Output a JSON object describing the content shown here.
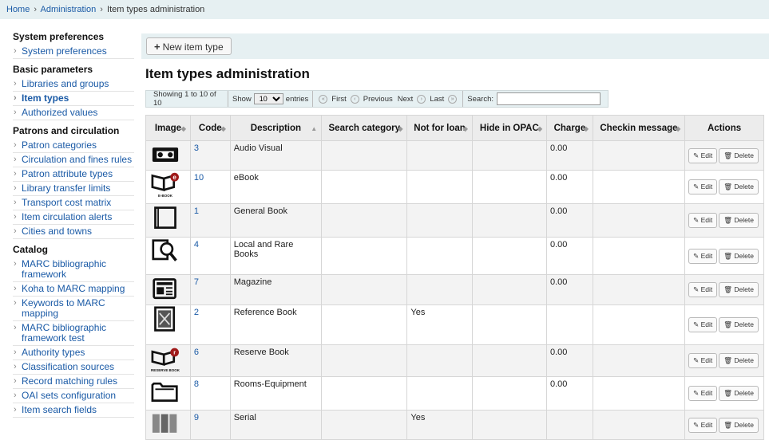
{
  "breadcrumbs": {
    "home": "Home",
    "sep": "›",
    "administration": "Administration",
    "current": "Item types administration"
  },
  "sidebar": {
    "sections": [
      {
        "title": "System preferences",
        "items": [
          {
            "label": "System preferences"
          }
        ]
      },
      {
        "title": "Basic parameters",
        "items": [
          {
            "label": "Libraries and groups"
          },
          {
            "label": "Item types",
            "active": true
          },
          {
            "label": "Authorized values"
          }
        ]
      },
      {
        "title": "Patrons and circulation",
        "items": [
          {
            "label": "Patron categories"
          },
          {
            "label": "Circulation and fines rules"
          },
          {
            "label": "Patron attribute types"
          },
          {
            "label": "Library transfer limits"
          },
          {
            "label": "Transport cost matrix"
          },
          {
            "label": "Item circulation alerts"
          },
          {
            "label": "Cities and towns"
          }
        ]
      },
      {
        "title": "Catalog",
        "items": [
          {
            "label": "MARC bibliographic framework"
          },
          {
            "label": "Koha to MARC mapping"
          },
          {
            "label": "Keywords to MARC mapping"
          },
          {
            "label": "MARC bibliographic framework test"
          },
          {
            "label": "Authority types"
          },
          {
            "label": "Classification sources"
          },
          {
            "label": "Record matching rules"
          },
          {
            "label": "OAI sets configuration"
          },
          {
            "label": "Item search fields"
          }
        ]
      }
    ]
  },
  "toolbar": {
    "new_label": "New item type",
    "plus": "+"
  },
  "page_title": "Item types administration",
  "pager": {
    "showing": "Showing 1 to 10 of 10",
    "show": "Show",
    "length": "10",
    "entries": "entries",
    "first": "First",
    "previous": "Previous",
    "next": "Next",
    "last": "Last",
    "search_label": "Search:",
    "search_value": ""
  },
  "table": {
    "headers": {
      "image": "Image",
      "code": "Code",
      "description": "Description",
      "search_category": "Search category",
      "not_for_loan": "Not for loan",
      "hide_opac": "Hide in OPAC",
      "charge": "Charge",
      "checkin_message": "Checkin message",
      "actions": "Actions"
    },
    "edit_label": "Edit",
    "delete_label": "Delete",
    "rows": [
      {
        "icon": "video-cassette-icon",
        "code": "3",
        "description": "Audio Visual",
        "search_category": "",
        "not_for_loan": "",
        "hide_opac": "",
        "charge": "0.00",
        "checkin_message": ""
      },
      {
        "icon": "ebook-icon",
        "icon_caption": "E-BOOK",
        "code": "10",
        "description": "eBook",
        "search_category": "",
        "not_for_loan": "",
        "hide_opac": "",
        "charge": "0.00",
        "checkin_message": ""
      },
      {
        "icon": "book-icon",
        "code": "1",
        "description": "General Book",
        "search_category": "",
        "not_for_loan": "",
        "hide_opac": "",
        "charge": "0.00",
        "checkin_message": ""
      },
      {
        "icon": "magnifier-book-icon",
        "code": "4",
        "description": "Local and Rare Books",
        "search_category": "",
        "not_for_loan": "",
        "hide_opac": "",
        "charge": "0.00",
        "checkin_message": ""
      },
      {
        "icon": "magazine-icon",
        "code": "7",
        "description": "Magazine",
        "search_category": "",
        "not_for_loan": "",
        "hide_opac": "",
        "charge": "0.00",
        "checkin_message": ""
      },
      {
        "icon": "reference-book-icon",
        "code": "2",
        "description": "Reference Book",
        "search_category": "",
        "not_for_loan": "Yes",
        "hide_opac": "",
        "charge": "",
        "checkin_message": ""
      },
      {
        "icon": "reserve-book-icon",
        "icon_caption": "RESERVE BOOK",
        "code": "6",
        "description": "Reserve Book",
        "search_category": "",
        "not_for_loan": "",
        "hide_opac": "",
        "charge": "0.00",
        "checkin_message": ""
      },
      {
        "icon": "folder-icon",
        "code": "8",
        "description": "Rooms-Equipment",
        "search_category": "",
        "not_for_loan": "",
        "hide_opac": "",
        "charge": "0.00",
        "checkin_message": ""
      },
      {
        "icon": "serial-icon",
        "code": "9",
        "description": "Serial",
        "search_category": "",
        "not_for_loan": "Yes",
        "hide_opac": "",
        "charge": "",
        "checkin_message": ""
      }
    ]
  }
}
